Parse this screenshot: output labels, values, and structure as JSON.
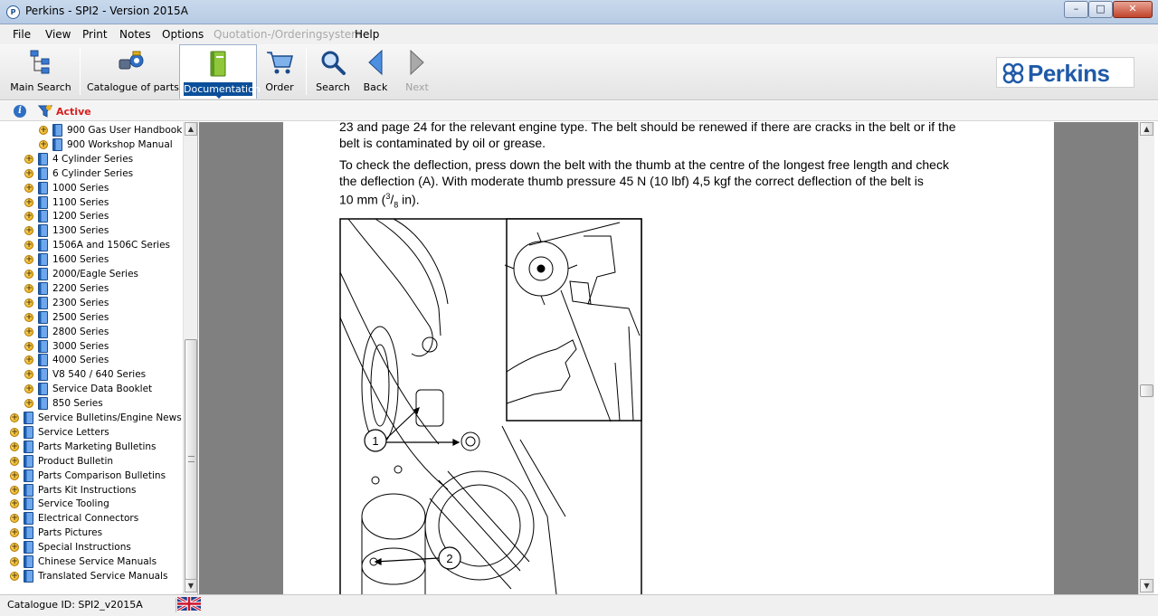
{
  "window": {
    "title": "Perkins - SPI2 - Version 2015A",
    "controls": {
      "minimize": "–",
      "maximize": "□",
      "close": "✕"
    }
  },
  "menu": {
    "file": "File",
    "view": "View",
    "print": "Print",
    "notes": "Notes",
    "options": "Options",
    "quotation": "Quotation-/Orderingsystem",
    "help": "Help"
  },
  "toolbar": {
    "main_search": "Main Search",
    "catalogue": "Catalogue of parts",
    "documentation": "Documentation",
    "order": "Order",
    "search": "Search",
    "back": "Back",
    "next": "Next",
    "active_item": "documentation"
  },
  "brand": {
    "logo_text": "Perkins",
    "color": "#1f5aa8"
  },
  "filter": {
    "label": "Active",
    "color": "#d81e1e",
    "info_icon": "i"
  },
  "tree": {
    "items": [
      {
        "label": "900 Gas User Handbook",
        "level": 2
      },
      {
        "label": "900 Workshop Manual",
        "level": 2
      },
      {
        "label": "4 Cylinder Series",
        "level": 1
      },
      {
        "label": "6 Cylinder Series",
        "level": 1
      },
      {
        "label": "1000 Series",
        "level": 1
      },
      {
        "label": "1100 Series",
        "level": 1
      },
      {
        "label": "1200 Series",
        "level": 1
      },
      {
        "label": "1300 Series",
        "level": 1
      },
      {
        "label": "1506A and 1506C Series",
        "level": 1
      },
      {
        "label": "1600 Series",
        "level": 1
      },
      {
        "label": "2000/Eagle Series",
        "level": 1
      },
      {
        "label": "2200 Series",
        "level": 1
      },
      {
        "label": "2300 Series",
        "level": 1
      },
      {
        "label": "2500 Series",
        "level": 1
      },
      {
        "label": "2800 Series",
        "level": 1
      },
      {
        "label": "3000 Series",
        "level": 1
      },
      {
        "label": "4000 Series",
        "level": 1
      },
      {
        "label": "V8 540 / 640 Series",
        "level": 1
      },
      {
        "label": "Service Data Booklet",
        "level": 1
      },
      {
        "label": "850 Series",
        "level": 1
      },
      {
        "label": "Service Bulletins/Engine News",
        "level": 0
      },
      {
        "label": "Service Letters",
        "level": 0
      },
      {
        "label": "Parts Marketing Bulletins",
        "level": 0
      },
      {
        "label": "Product Bulletin",
        "level": 0
      },
      {
        "label": "Parts Comparison Bulletins",
        "level": 0
      },
      {
        "label": "Parts Kit Instructions",
        "level": 0
      },
      {
        "label": "Service Tooling",
        "level": 0
      },
      {
        "label": "Electrical Connectors",
        "level": 0
      },
      {
        "label": "Parts Pictures",
        "level": 0
      },
      {
        "label": "Special Instructions",
        "level": 0
      },
      {
        "label": "Chinese Service Manuals",
        "level": 0
      },
      {
        "label": "Translated Service Manuals",
        "level": 0
      }
    ]
  },
  "document": {
    "para1_line1": "23 and page 24 for the relevant engine type. The belt should be renewed if there are cracks in the belt or if the",
    "para1_line2": "belt is contaminated by oil or grease.",
    "para2_line1": "To check the deflection, press down the belt with the thumb at the centre of the longest free length and check",
    "para2_line2": "the deflection (A). With moderate thumb pressure 45 N (10 lbf) 4,5 kgf the correct deflection of the belt is",
    "para2_line3_prefix": "10 mm (",
    "fraction_num": "3",
    "fraction_sep": "/",
    "fraction_den": "8",
    "para2_line3_suffix": " in).",
    "callout_1": "1",
    "callout_2": "2"
  },
  "status": {
    "catalogue_id": "Catalogue ID: SPI2_v2015A",
    "language_flag": "uk-flag-icon"
  }
}
